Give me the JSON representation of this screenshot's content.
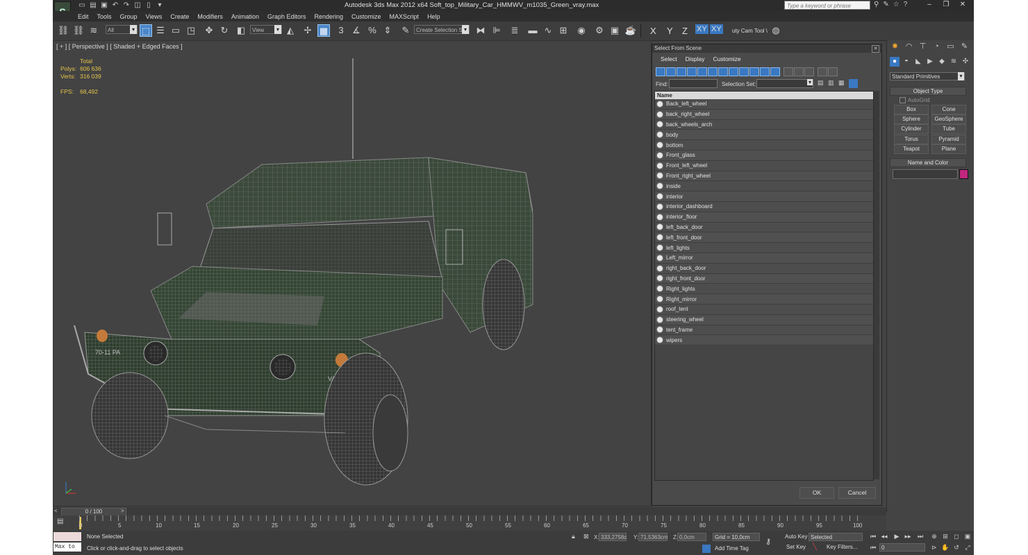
{
  "window": {
    "title": "Autodesk 3ds Max  2012 x64     Soft_top_Military_Car_HMMWV_m1035_Green_vray.max",
    "search_placeholder": "Type a keyword or phrase"
  },
  "menu": [
    "Edit",
    "Tools",
    "Group",
    "Views",
    "Create",
    "Modifiers",
    "Animation",
    "Graph Editors",
    "Rendering",
    "Customize",
    "MAXScript",
    "Help"
  ],
  "toolbar": {
    "filter_value": "All",
    "reference_coord": "View",
    "selection_set": "Create Selection Se",
    "axis_labels": [
      "X",
      "Y",
      "Z",
      "XY",
      "XY"
    ],
    "cam_tool": "uty Cam Tool \\"
  },
  "viewport": {
    "label": "[ + ] [ Perspective ] [ Shaded + Edged Faces ]",
    "stats_header": "Total",
    "polys_label": "Polys:",
    "polys_value": "606 636",
    "verts_label": "Verts:",
    "verts_value": "316 039",
    "fps_label": "FPS:",
    "fps_value": "68,492",
    "plates": [
      "70-11  PA",
      "VA-7"
    ]
  },
  "dialog": {
    "title": "Select From Scene",
    "menu": [
      "Select",
      "Display",
      "Customize"
    ],
    "find_label": "Find:",
    "selection_set_label": "Selection Set:",
    "column_header": "Name",
    "items": [
      "Back_left_wheel",
      "back_right_wheel",
      "back_wheels_arch",
      "body",
      "bottom",
      "Front_glass",
      "Front_left_wheel",
      "Front_right_wheel",
      "inside",
      "interior",
      "interior_dashboard",
      "interior_floor",
      "left_back_door",
      "left_front_door",
      "left_lights",
      "Left_mirror",
      "right_back_door",
      "right_front_door",
      "Right_lights",
      "Right_mirror",
      "roof_tent",
      "steering_wheel",
      "tent_frame",
      "wipers"
    ],
    "ok_label": "OK",
    "cancel_label": "Cancel"
  },
  "command_panel": {
    "dropdown": "Standard Primitives",
    "object_type": "Object Type",
    "autogrid": "AutoGrid",
    "buttons": [
      "Box",
      "Cone",
      "Sphere",
      "GeoSphere",
      "Cylinder",
      "Tube",
      "Torus",
      "Pyramid",
      "Teapot",
      "Plane"
    ],
    "name_and_color": "Name and Color",
    "accent_color": "#c2267f"
  },
  "timeline": {
    "slider": "0 / 100",
    "ticks": [
      "0",
      "5",
      "10",
      "15",
      "20",
      "25",
      "30",
      "35",
      "40",
      "45",
      "50",
      "55",
      "60",
      "65",
      "70",
      "75",
      "80",
      "85",
      "90",
      "95",
      "100"
    ]
  },
  "status": {
    "maxscript": "Max to",
    "selected": "None Selected",
    "prompt": "Click or click-and-drag to select objects",
    "x_label": "X:",
    "x_value": "333,2758c",
    "y_label": "Y:",
    "y_value": "71,5363cm",
    "z_label": "Z:",
    "z_value": "0,0cm",
    "grid": "Grid = 10,0cm",
    "add_time_tag": "Add Time Tag",
    "auto_key": "Auto Key",
    "auto_key_value": "Selected",
    "set_key": "Set Key",
    "key_filters": "Key Filters...",
    "frame_value": "0"
  }
}
